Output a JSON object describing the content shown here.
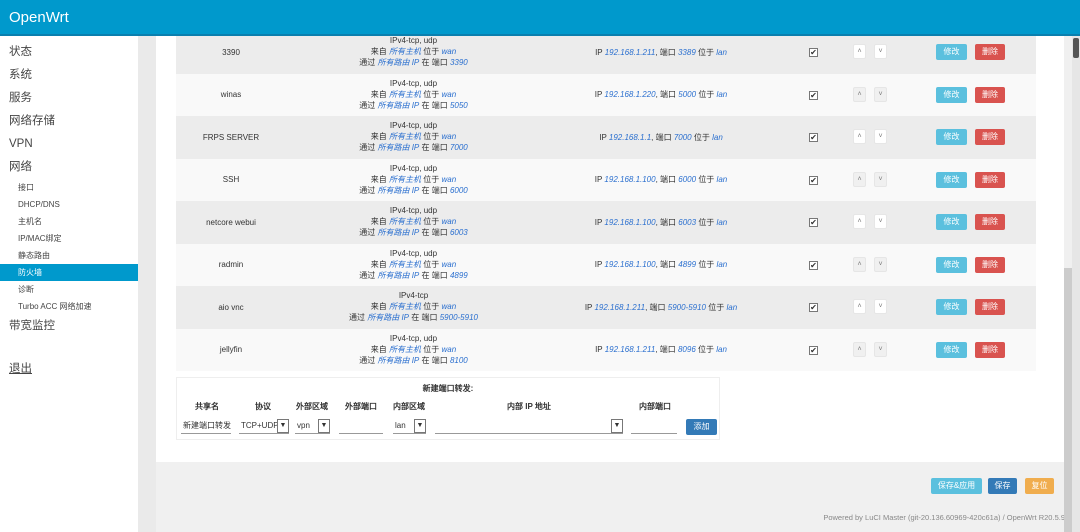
{
  "header": {
    "brand": "OpenWrt"
  },
  "sidebar": {
    "items": [
      "状态",
      "系统",
      "服务",
      "网络存储",
      "VPN",
      "网络"
    ],
    "sub": [
      "接口",
      "DHCP/DNS",
      "主机名",
      "IP/MAC绑定",
      "静态路由",
      "防火墙",
      "诊断",
      "Turbo ACC 网络加速"
    ],
    "after": "带宽监控",
    "logout": "退出",
    "active": "防火墙"
  },
  "labels": {
    "from": "来自",
    "any_host": "所有主机",
    "in": "位于",
    "via": "通过",
    "any_router_ip": "所有路由 IP",
    "at": "在",
    "port": "端口",
    "ip": "IP",
    "edit": "修改",
    "delete": "删除",
    "up": "˄",
    "down": "˅",
    "check": "✔"
  },
  "rules": [
    {
      "name": "3390",
      "proto": "IPv4-tcp, udp",
      "src_zone": "wan",
      "ext_port": "3390",
      "ip": "192.168.1.211",
      "int_port": "3389",
      "dest_zone": "lan",
      "enabled": true
    },
    {
      "name": "winas",
      "proto": "IPv4-tcp, udp",
      "src_zone": "wan",
      "ext_port": "5050",
      "ip": "192.168.1.220",
      "int_port": "5000",
      "dest_zone": "lan",
      "enabled": true
    },
    {
      "name": "FRPS SERVER",
      "proto": "IPv4-tcp, udp",
      "src_zone": "wan",
      "ext_port": "7000",
      "ip": "192.168.1.1",
      "int_port": "7000",
      "dest_zone": "lan",
      "enabled": true
    },
    {
      "name": "SSH",
      "proto": "IPv4-tcp, udp",
      "src_zone": "wan",
      "ext_port": "6000",
      "ip": "192.168.1.100",
      "int_port": "6000",
      "dest_zone": "lan",
      "enabled": true
    },
    {
      "name": "netcore webui",
      "proto": "IPv4-tcp, udp",
      "src_zone": "wan",
      "ext_port": "6003",
      "ip": "192.168.1.100",
      "int_port": "6003",
      "dest_zone": "lan",
      "enabled": true
    },
    {
      "name": "radmin",
      "proto": "IPv4-tcp, udp",
      "src_zone": "wan",
      "ext_port": "4899",
      "ip": "192.168.1.100",
      "int_port": "4899",
      "dest_zone": "lan",
      "enabled": true
    },
    {
      "name": "aio vnc",
      "proto": "IPv4-tcp",
      "src_zone": "wan",
      "ext_port": "5900-5910",
      "ip": "192.168.1.211",
      "int_port": "5900-5910",
      "dest_zone": "lan",
      "enabled": true
    },
    {
      "name": "jellyfin",
      "proto": "IPv4-tcp, udp",
      "src_zone": "wan",
      "ext_port": "8100",
      "ip": "192.168.1.211",
      "int_port": "8096",
      "dest_zone": "lan",
      "enabled": true
    }
  ],
  "new_forward": {
    "title": "新建端口转发:",
    "headers": [
      "共享名",
      "协议",
      "外部区域",
      "外部端口",
      "内部区域",
      "内部 IP 地址",
      "内部端口"
    ],
    "name_value": "新建端口转发",
    "proto": "TCP+UDP",
    "ext_zone": "vpn",
    "ext_port": "",
    "int_zone": "lan",
    "int_ip": "",
    "int_port": "",
    "add": "添加"
  },
  "actions": {
    "save_apply": "保存&应用",
    "save": "保存",
    "reset": "复位"
  },
  "footer": "Powered by LuCI Master (git-20.136.60969-420c61a) / OpenWrt R20.5.9",
  "colors": {
    "header": "#0099cc",
    "edit": "#5bc0de",
    "delete": "#d9534f",
    "save": "#337ab7",
    "reset": "#f0ad4e"
  }
}
